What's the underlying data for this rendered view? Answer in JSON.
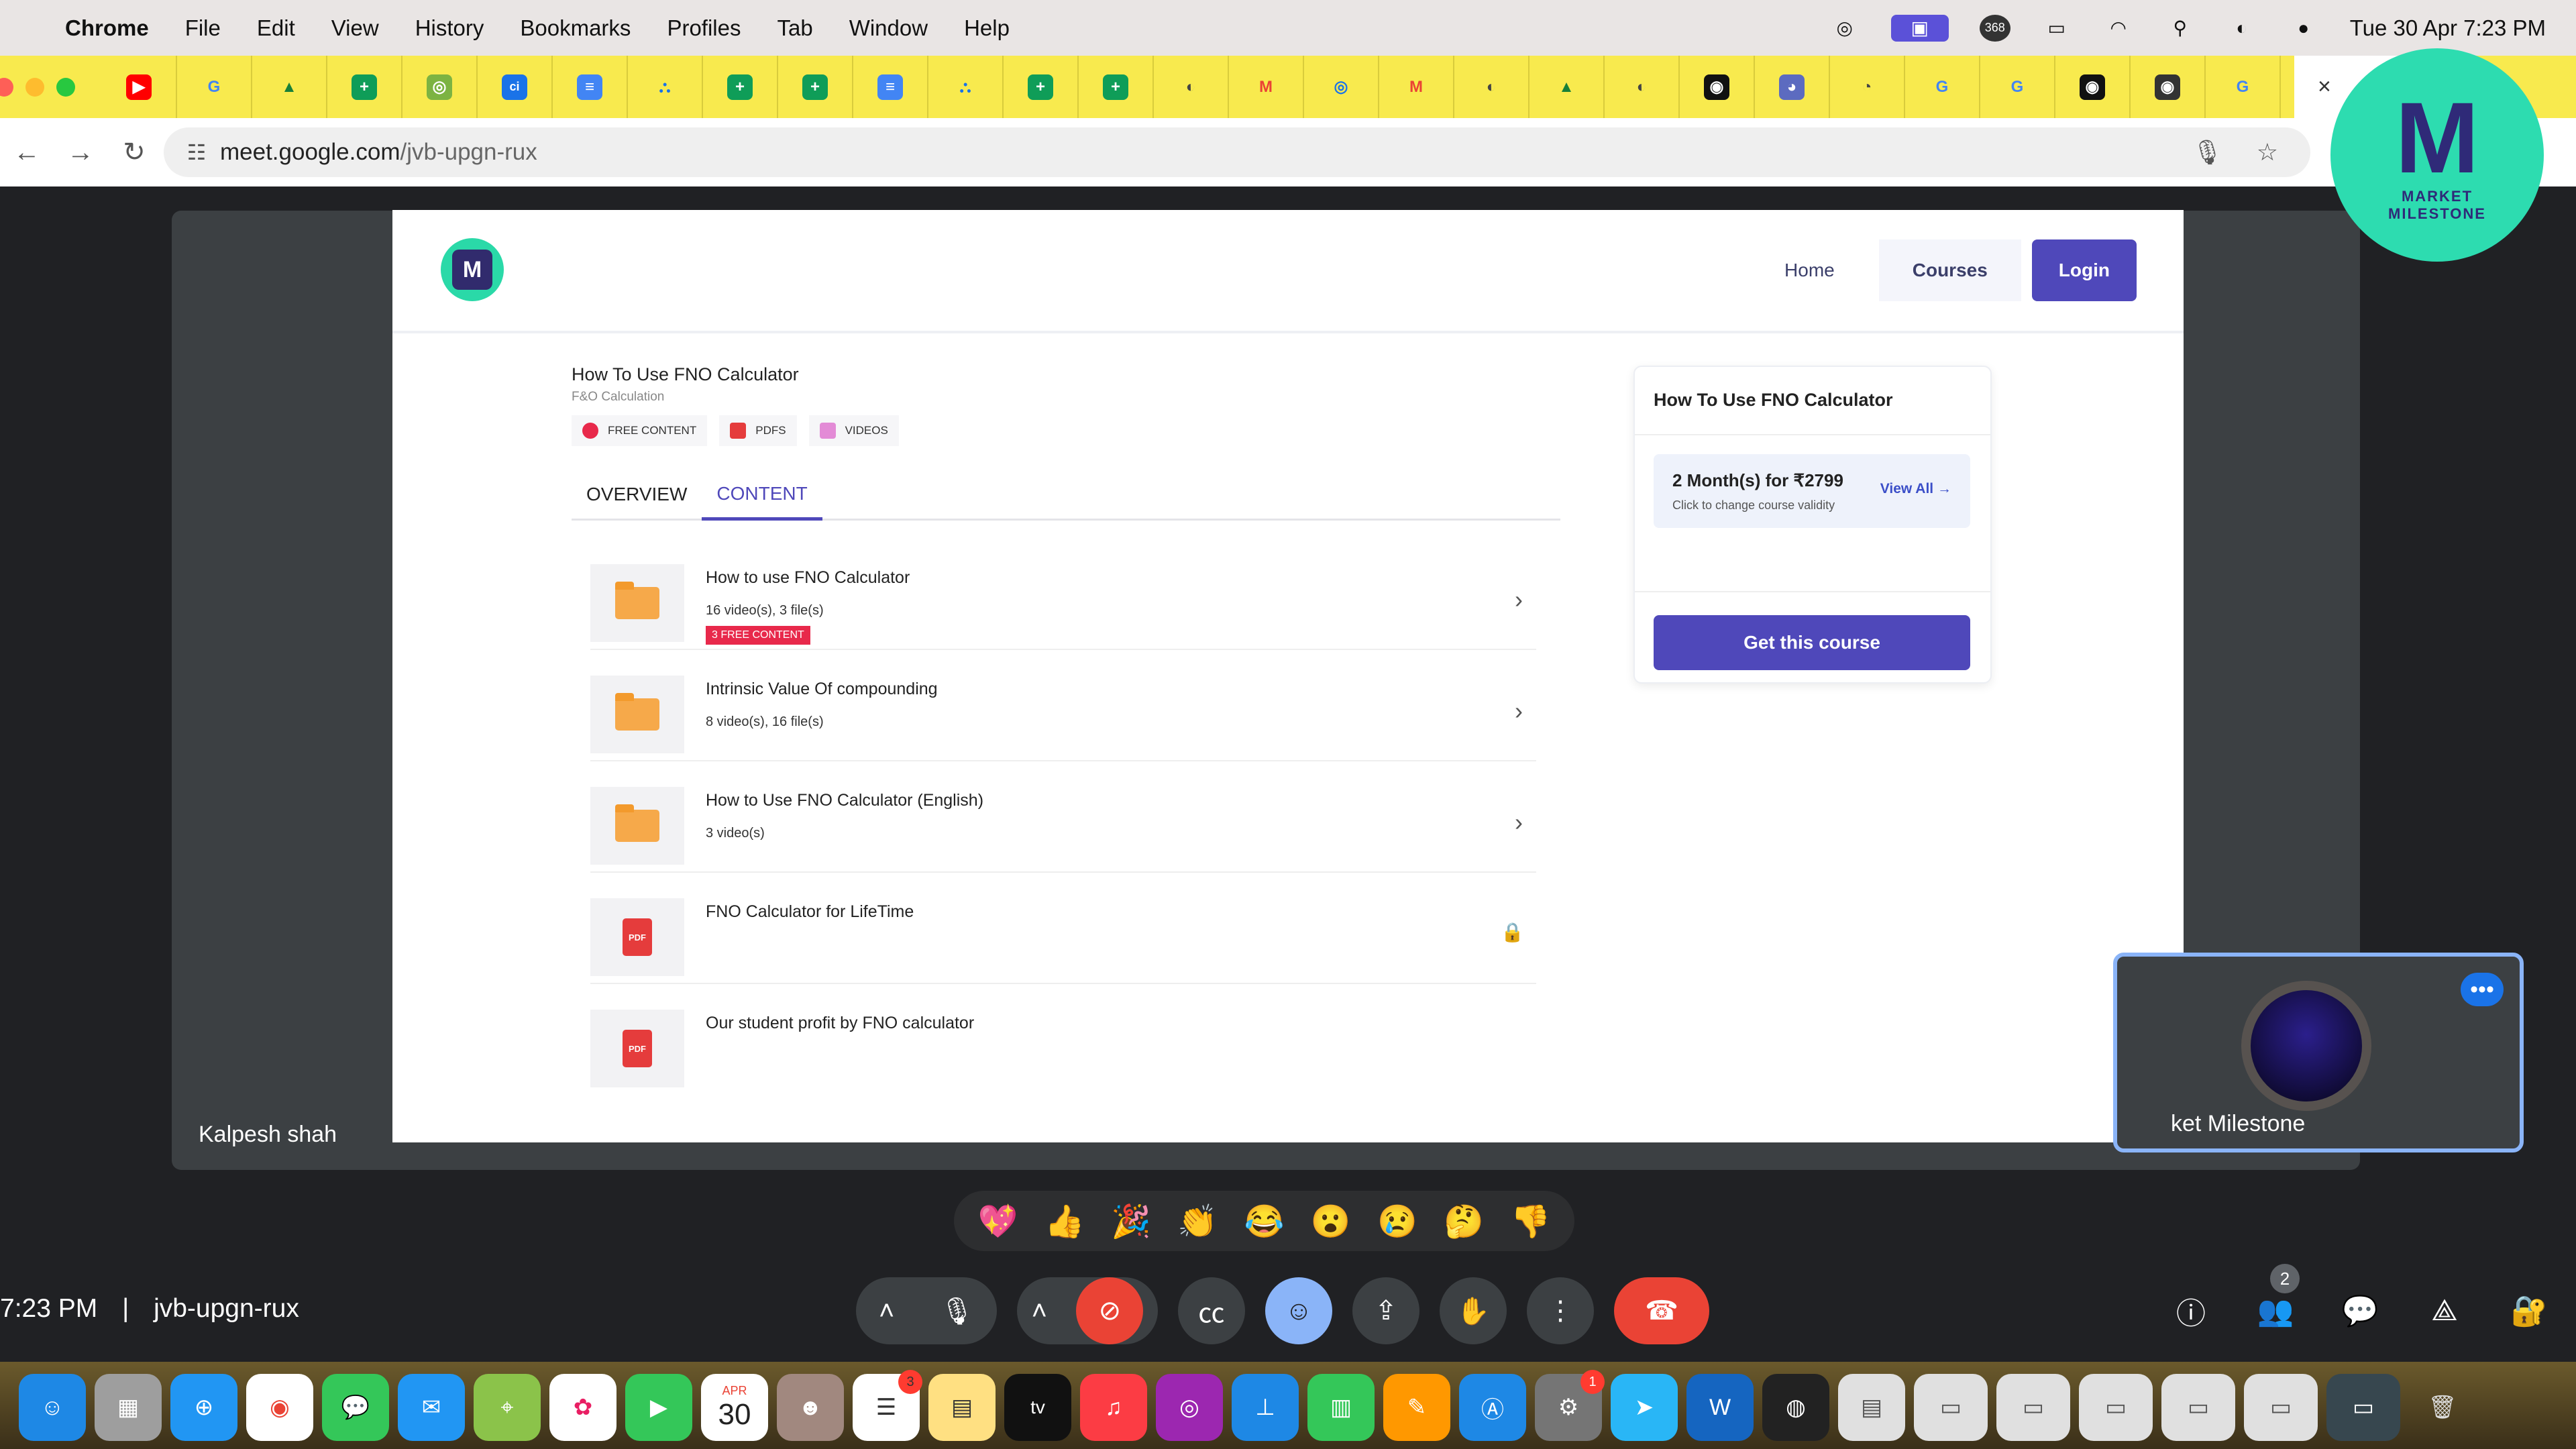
{
  "menubar": {
    "app": "Chrome",
    "menus": [
      "File",
      "Edit",
      "View",
      "History",
      "Bookmarks",
      "Profiles",
      "Tab",
      "Window",
      "Help"
    ],
    "badge_count": "368",
    "datetime": "Tue 30 Apr  7:23 PM"
  },
  "browser": {
    "url_host": "meet.google.com",
    "url_path": "/jvb-upgn-rux",
    "tab_close": "×"
  },
  "site": {
    "nav": {
      "home": "Home",
      "courses": "Courses",
      "login": "Login"
    },
    "course_title": "How To Use FNO Calculator",
    "course_subtitle": "F&O Calculation",
    "badges": [
      "FREE CONTENT",
      "PDFS",
      "VIDEOS"
    ],
    "tabs": [
      "OVERVIEW",
      "CONTENT"
    ],
    "items": [
      {
        "title": "How to use FNO Calculator",
        "meta": "16 video(s), 3 file(s)",
        "free": "3 FREE CONTENT",
        "type": "folder"
      },
      {
        "title": "Intrinsic Value Of compounding",
        "meta": "8 video(s), 16 file(s)",
        "type": "folder"
      },
      {
        "title": "How to Use FNO Calculator (English)",
        "meta": "3 video(s)",
        "type": "folder"
      },
      {
        "title": "FNO Calculator for LifeTime",
        "type": "pdf"
      },
      {
        "title": "Our student profit by FNO calculator",
        "type": "pdf"
      }
    ],
    "pdf_label": "PDF",
    "card": {
      "title": "How To Use FNO Calculator",
      "price": "2 Month(s) for ₹2799",
      "price_desc": "Click to change course validity",
      "view_all": "View All",
      "cta": "Get this course"
    }
  },
  "meet": {
    "presenter": "Kalpesh shah",
    "self_name": "ket Milestone",
    "time": "7:23 PM",
    "code": "jvb-upgn-rux",
    "participants": "2",
    "reactions": [
      "💖",
      "👍",
      "🎉",
      "👏",
      "😂",
      "😮",
      "😢",
      "🤔",
      "👎"
    ]
  },
  "logo": {
    "line1": "MARKET",
    "line2": "MILESTONE"
  },
  "dock": {
    "calendar_month": "APR",
    "calendar_day": "30",
    "reminders_badge": "3",
    "settings_badge": "1",
    "tv_label": "tv"
  }
}
